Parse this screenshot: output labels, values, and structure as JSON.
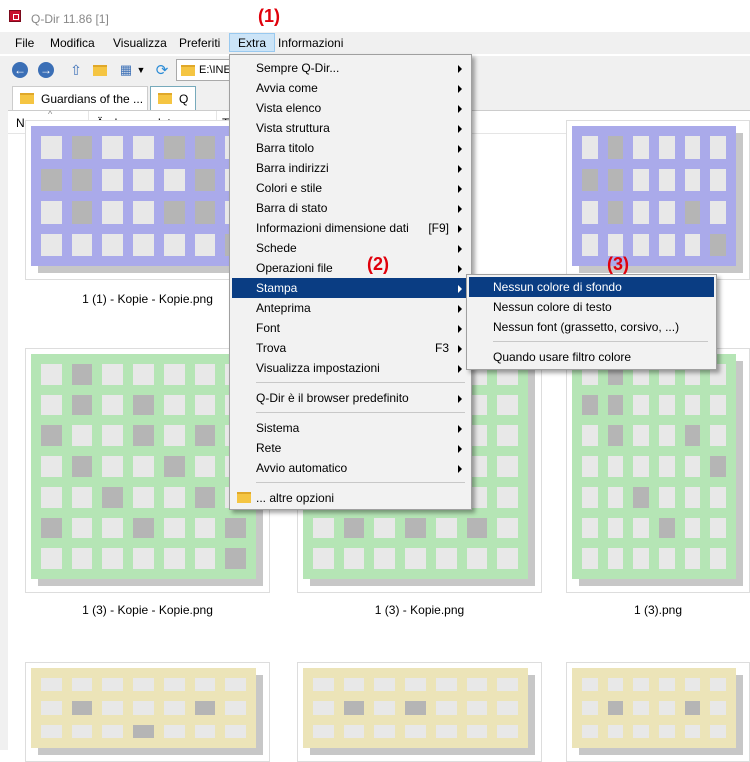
{
  "window": {
    "title": "Q-Dir 11.86 [1]"
  },
  "menubar": [
    "File",
    "Modifica",
    "Visualizza",
    "Preferiti",
    "Extra",
    "Informazioni"
  ],
  "callouts": {
    "c1": "(1)",
    "c2": "(2)",
    "c3": "(3)"
  },
  "address": {
    "value": "E:\\INE"
  },
  "tabs": [
    "Guardians of the ...",
    "Q"
  ],
  "columns": [
    "Name",
    "Änderungsdatum",
    "Ty"
  ],
  "files": [
    "1 (1) - Kopie - Kopie.png",
    "1 (3) - Kopie - Kopie.png",
    "1 (3) - Kopie.png",
    "1 (3).png"
  ],
  "colors": {
    "purple": "#aaaaea",
    "green": "#b5e5b5",
    "yellow": "#ece4b8",
    "menu_highlight": "#0a3d83"
  },
  "extra_menu": [
    {
      "label": "Sempre Q-Dir...",
      "arrow": true
    },
    {
      "label": "Avvia come",
      "arrow": true
    },
    {
      "label": "Vista elenco",
      "arrow": true
    },
    {
      "label": "Vista struttura",
      "arrow": true
    },
    {
      "label": "Barra titolo",
      "arrow": true
    },
    {
      "label": "Barra indirizzi",
      "arrow": true
    },
    {
      "label": "Colori e stile",
      "arrow": true
    },
    {
      "label": "Barra di stato",
      "arrow": true
    },
    {
      "label": "Informazioni dimensione dati",
      "shortcut": "[F9]",
      "arrow": true
    },
    {
      "label": "Schede",
      "arrow": true
    },
    {
      "label": "Operazioni file",
      "arrow": true
    },
    {
      "label": "Stampa",
      "arrow": true,
      "selected": true
    },
    {
      "label": "Anteprima",
      "arrow": true
    },
    {
      "label": "Font",
      "arrow": true
    },
    {
      "label": "Trova",
      "shortcut": "F3",
      "arrow": true
    },
    {
      "label": "Visualizza impostazioni",
      "arrow": true
    },
    {
      "label": "Q-Dir è il browser predefinito",
      "arrow": true
    },
    {
      "label": "Sistema",
      "arrow": true
    },
    {
      "label": "Rete",
      "arrow": true
    },
    {
      "label": "Avvio automatico",
      "arrow": true
    },
    {
      "label": "... altre opzioni",
      "arrow": false
    }
  ],
  "stampa_submenu": [
    {
      "label": "Nessun colore di sfondo",
      "selected": true
    },
    {
      "label": "Nessun colore di testo"
    },
    {
      "label": "Nessun font (grassetto, corsivo, ...)"
    },
    {
      "label": "Quando usare filtro colore"
    }
  ]
}
